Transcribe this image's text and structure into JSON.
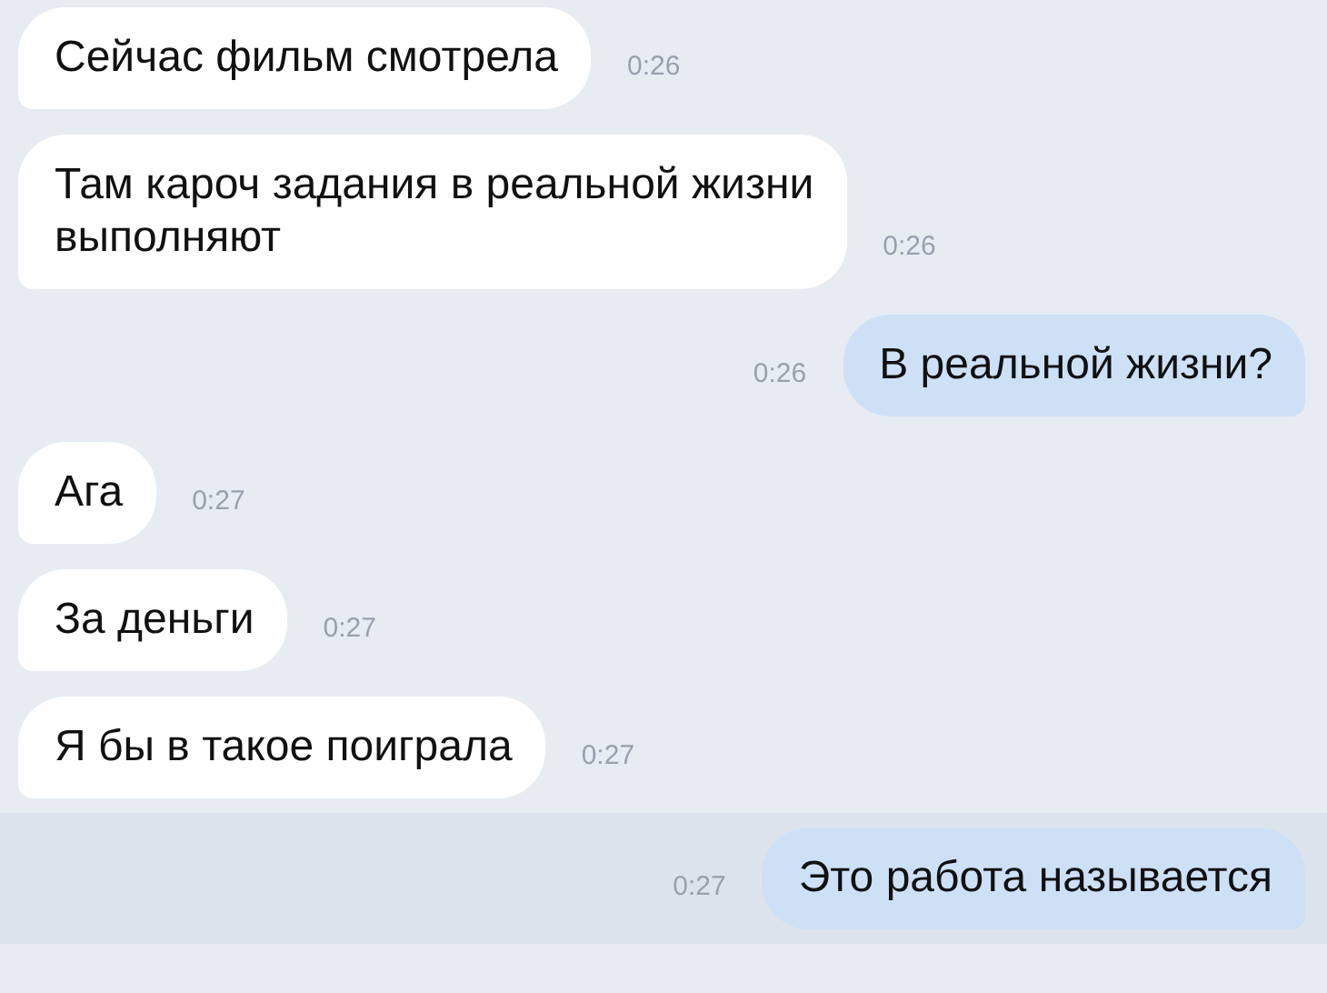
{
  "messages": [
    {
      "kind": "incoming",
      "text": "Сейчас фильм смотрела",
      "time": "0:26",
      "selected": false
    },
    {
      "kind": "incoming",
      "text": "Там кароч задания в реальной жизни\nвыполняют",
      "time": "0:26",
      "selected": false
    },
    {
      "kind": "outgoing",
      "text": "В реальной жизни?",
      "time": "0:26",
      "selected": false
    },
    {
      "kind": "incoming",
      "text": "Ага",
      "time": "0:27",
      "selected": false
    },
    {
      "kind": "incoming",
      "text": "За деньги",
      "time": "0:27",
      "selected": false
    },
    {
      "kind": "incoming",
      "text": "Я бы в такое поиграла",
      "time": "0:27",
      "selected": false
    },
    {
      "kind": "outgoing",
      "text": "Это работа называется",
      "time": "0:27",
      "selected": true
    }
  ]
}
